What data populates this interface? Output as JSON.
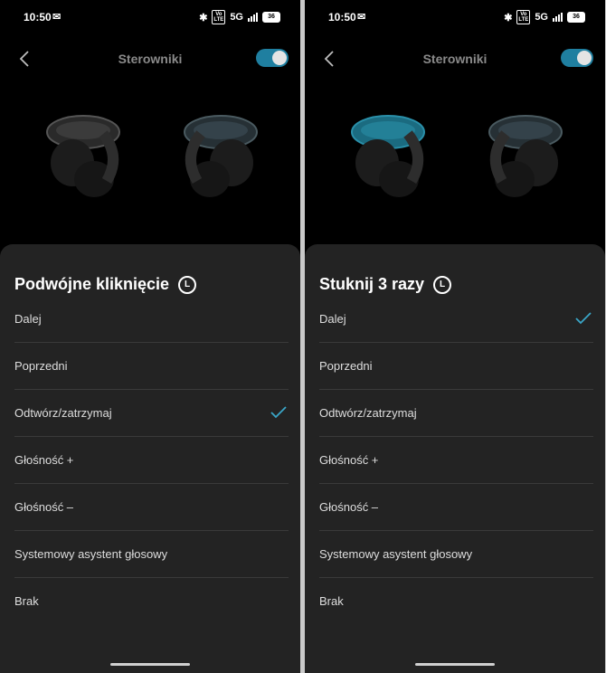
{
  "panels": [
    {
      "status": {
        "time": "10:50",
        "network": "5G",
        "volte": "Vo\nLTE",
        "battery": "36"
      },
      "header": {
        "title": "Sterowniki",
        "toggle_on": true
      },
      "sheet": {
        "title": "Podwójne kliknięcie",
        "side_badge": "L",
        "options": [
          {
            "label": "Dalej",
            "selected": false
          },
          {
            "label": "Poprzedni",
            "selected": false
          },
          {
            "label": "Odtwórz/zatrzymaj",
            "selected": true
          },
          {
            "label": "Głośność +",
            "selected": false
          },
          {
            "label": "Głośność –",
            "selected": false
          },
          {
            "label": "Systemowy asystent głosowy",
            "selected": false
          },
          {
            "label": "Brak",
            "selected": false
          }
        ]
      },
      "highlight": "right"
    },
    {
      "status": {
        "time": "10:50",
        "network": "5G",
        "volte": "Vo\nLTE",
        "battery": "36"
      },
      "header": {
        "title": "Sterowniki",
        "toggle_on": true
      },
      "sheet": {
        "title": "Stuknij 3 razy",
        "side_badge": "L",
        "options": [
          {
            "label": "Dalej",
            "selected": true
          },
          {
            "label": "Poprzedni",
            "selected": false
          },
          {
            "label": "Odtwórz/zatrzymaj",
            "selected": false
          },
          {
            "label": "Głośność +",
            "selected": false
          },
          {
            "label": "Głośność –",
            "selected": false
          },
          {
            "label": "Systemowy asystent głosowy",
            "selected": false
          },
          {
            "label": "Brak",
            "selected": false
          }
        ]
      },
      "highlight": "left"
    }
  ],
  "colors": {
    "accent": "#1f7fa0",
    "check": "#3aa6c8",
    "sheet_bg": "#232323"
  }
}
